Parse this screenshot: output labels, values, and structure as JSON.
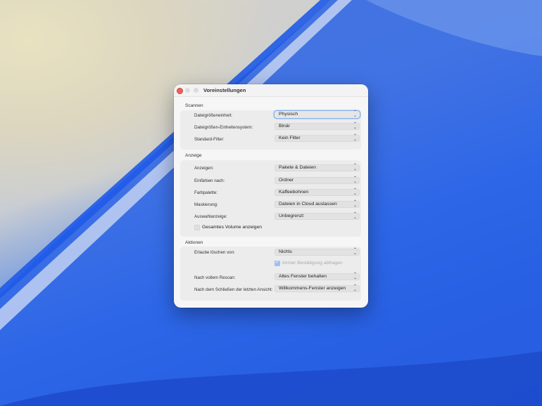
{
  "window": {
    "title": "Voreinstellungen"
  },
  "scannen": {
    "header": "Scannen",
    "rows": [
      {
        "label": "Dateigrößeneinheit:",
        "value": "Physisch"
      },
      {
        "label": "Dateigrößen-Einheitensystem:",
        "value": "Binär"
      },
      {
        "label": "Standard-Filter:",
        "value": "Kein Filter"
      }
    ]
  },
  "anzeige": {
    "header": "Anzeige",
    "rows": [
      {
        "label": "Anzeigen:",
        "value": "Pakete & Dateien"
      },
      {
        "label": "Einfärben nach:",
        "value": "Ordner"
      },
      {
        "label": "Farbpalette:",
        "value": "Kaffeebohnen"
      },
      {
        "label": "Maskierung:",
        "value": "Dateien in Cloud auslassen"
      },
      {
        "label": "Auswahlanzeige:",
        "value": "Unbegrenzt"
      }
    ],
    "volume_checkbox": {
      "label": "Gesamtes Volume anzeigen",
      "checked": false
    }
  },
  "aktionen": {
    "header": "Aktionen",
    "delete_label": "Erlaube löschen von:",
    "delete_value": "Nichts",
    "confirm_checkbox": {
      "label": "Immer Bestätigung abfragen",
      "checked": true,
      "disabled": true
    },
    "rescan_label": "Nach vollem Rescan:",
    "rescan_value": "Altes Fenster behalten",
    "close_label": "Nach dem Schließen der letzten Ansicht:",
    "close_value": "Willkommens-Fenster anzeigen"
  },
  "colors": {
    "close": "#ec5f57",
    "accent": "#8cb4f0"
  }
}
